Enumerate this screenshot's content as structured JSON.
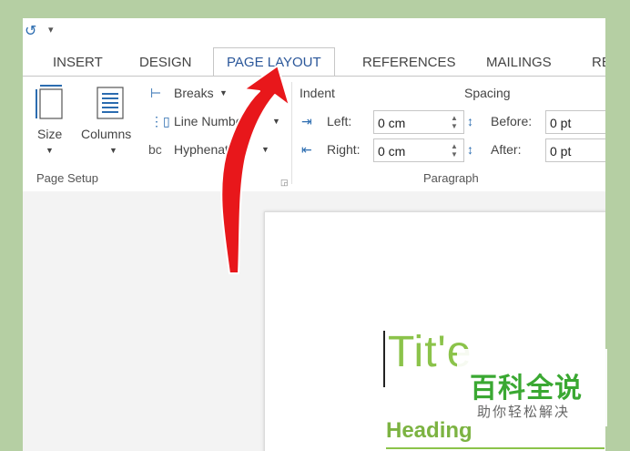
{
  "qat": {
    "undo_icon": "undo-icon",
    "customize_icon": "customize-icon"
  },
  "tabs": [
    "INSERT",
    "DESIGN",
    "PAGE LAYOUT",
    "REFERENCES",
    "MAILINGS",
    "RE"
  ],
  "active_tab": "PAGE LAYOUT",
  "page_setup": {
    "size": "Size",
    "columns": "Columns",
    "breaks": "Breaks",
    "line_numbers": "Line Numbers",
    "hyphenation": "Hyphenation",
    "group_label": "Page Setup"
  },
  "paragraph": {
    "indent_title": "Indent",
    "spacing_title": "Spacing",
    "left_label": "Left:",
    "right_label": "Right:",
    "before_label": "Before:",
    "after_label": "After:",
    "left_value": "0 cm",
    "right_value": "0 cm",
    "before_value": "0 pt",
    "after_value": "0 pt",
    "group_label": "Paragraph"
  },
  "document": {
    "title": "Tit'e",
    "heading": "Heading"
  },
  "watermark": {
    "main": "百科全说",
    "sub": "助你轻松解决"
  },
  "colors": {
    "accent": "#2b579a",
    "title_green": "#8bc34a",
    "arrow_red": "#e8171b",
    "background": "#b5cfa3"
  }
}
